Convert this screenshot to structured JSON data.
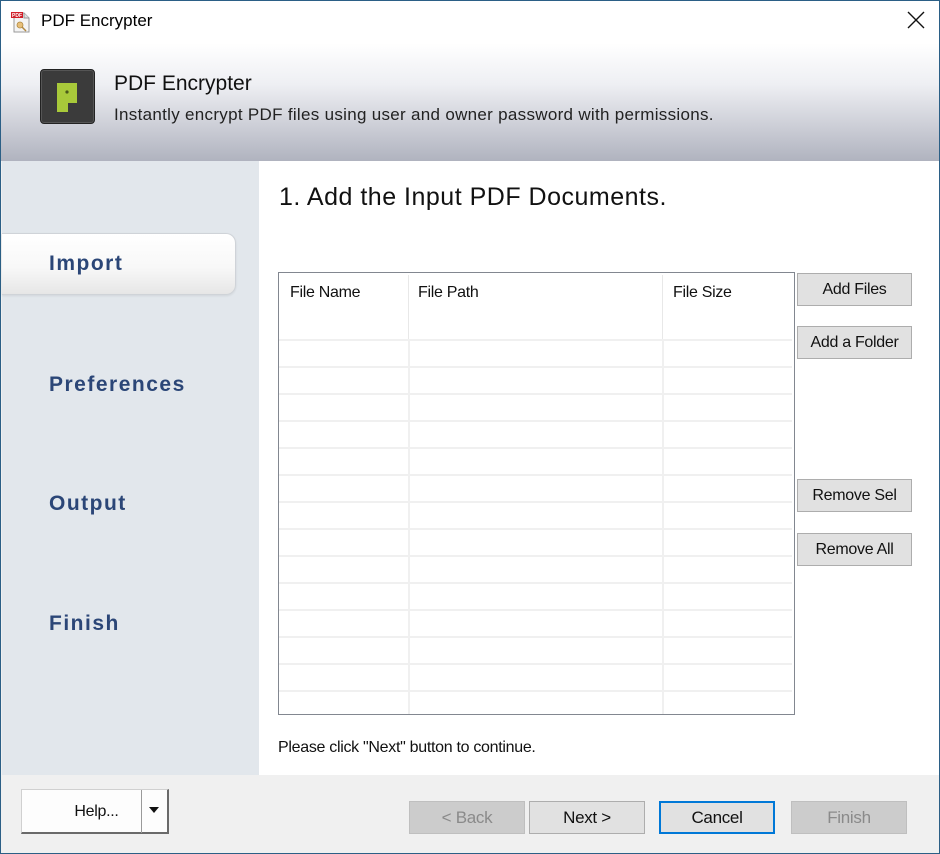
{
  "window": {
    "title": "PDF Encrypter",
    "icons": {
      "app": "pdf-document-icon",
      "close": "close-icon"
    }
  },
  "header": {
    "title": "PDF Encrypter",
    "subtitle": "Instantly encrypt PDF files using user and owner password with permissions.",
    "logo_icon": "p-logo-icon",
    "logo_letter": "P",
    "logo_color": "#a8c93a"
  },
  "sidebar": {
    "items": [
      {
        "label": "Import",
        "active": true
      },
      {
        "label": "Preferences",
        "active": false
      },
      {
        "label": "Output",
        "active": false
      },
      {
        "label": "Finish",
        "active": false
      }
    ]
  },
  "main": {
    "step_title": "1. Add the Input PDF Documents.",
    "table": {
      "columns": [
        "File Name",
        "File Path",
        "File Size"
      ],
      "rows": []
    },
    "buttons": {
      "add_files": "Add Files",
      "add_folder": "Add a Folder",
      "remove_sel": "Remove Sel",
      "remove_all": "Remove All"
    },
    "hint": "Please click \"Next\" button to continue."
  },
  "footer": {
    "help": "Help...",
    "back": "< Back",
    "next": "Next >",
    "cancel": "Cancel",
    "finish": "Finish",
    "back_enabled": false,
    "finish_enabled": false,
    "focus_color": "#0078d7"
  }
}
